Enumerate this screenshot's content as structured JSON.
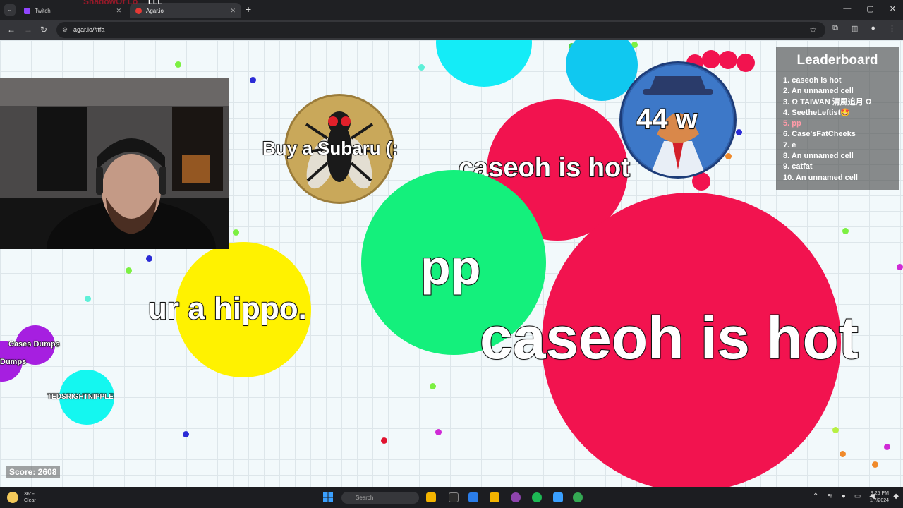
{
  "browser": {
    "tabs": [
      {
        "title": "Twitch",
        "fav_color": "#9146ff"
      },
      {
        "title": "Agar.io",
        "fav_color": "#e53935"
      }
    ],
    "stream_title_ghost": "ShadowOf Lo",
    "stream_title_ghost2": "LLL",
    "url": "agar.io/#ffa",
    "icons": [
      "tab-list-icon",
      "close-icon",
      "plus-icon",
      "minimize-icon",
      "maximize-icon",
      "back-icon",
      "forward-icon",
      "reload-icon",
      "site-info-icon",
      "star-icon",
      "extensions-icon",
      "side-panel-icon",
      "profile-icon",
      "menu-icon"
    ]
  },
  "game": {
    "cells": [
      {
        "id": "pp",
        "name": "pp",
        "color": "#14f07c"
      },
      {
        "id": "caseoh-big",
        "name": "caseoh is hot",
        "color": "#f2134f"
      },
      {
        "id": "caseoh-small",
        "name": "caseoh is hot",
        "color": "#f2134f"
      },
      {
        "id": "hippo",
        "name": "ur a hippo.",
        "color": "#fff200"
      },
      {
        "id": "subaru",
        "name": "Buy a Subaru (:",
        "skin": "fly-skin"
      },
      {
        "id": "wolf",
        "name": "44 w",
        "skin": "wolf-skin"
      },
      {
        "id": "teds",
        "name": "TEDSRIGHTNIPPLE",
        "color": "#14f7f0"
      },
      {
        "id": "dumps-a",
        "name": "Cases Dumps",
        "color": "#a61fe0"
      },
      {
        "id": "dumps-b",
        "name": "Dumps",
        "color": "#a61fe0"
      }
    ],
    "leaderboard": {
      "title": "Leaderboard",
      "entries": [
        "1. caseoh is hot",
        "2. An unnamed cell",
        "3. Ω TAIWAN 清風追月 Ω",
        "4. SeetheLeftist🤩",
        "5. pp",
        "6. Case'sFatCheeks",
        "7. e",
        "8. An unnamed cell",
        "9. catfat",
        "10. An unnamed cell"
      ],
      "player_rank": 5
    },
    "score": "Score: 2608"
  },
  "taskbar": {
    "temperature": "36°F",
    "condition": "Clear",
    "search_placeholder": "Search",
    "time": "9:25 PM",
    "date": "1/7/2024",
    "app_colors": [
      "#f4b400",
      "#2b7de9",
      "#8e44ad",
      "#1db954",
      "#3aa0ff",
      "#34a853"
    ]
  }
}
